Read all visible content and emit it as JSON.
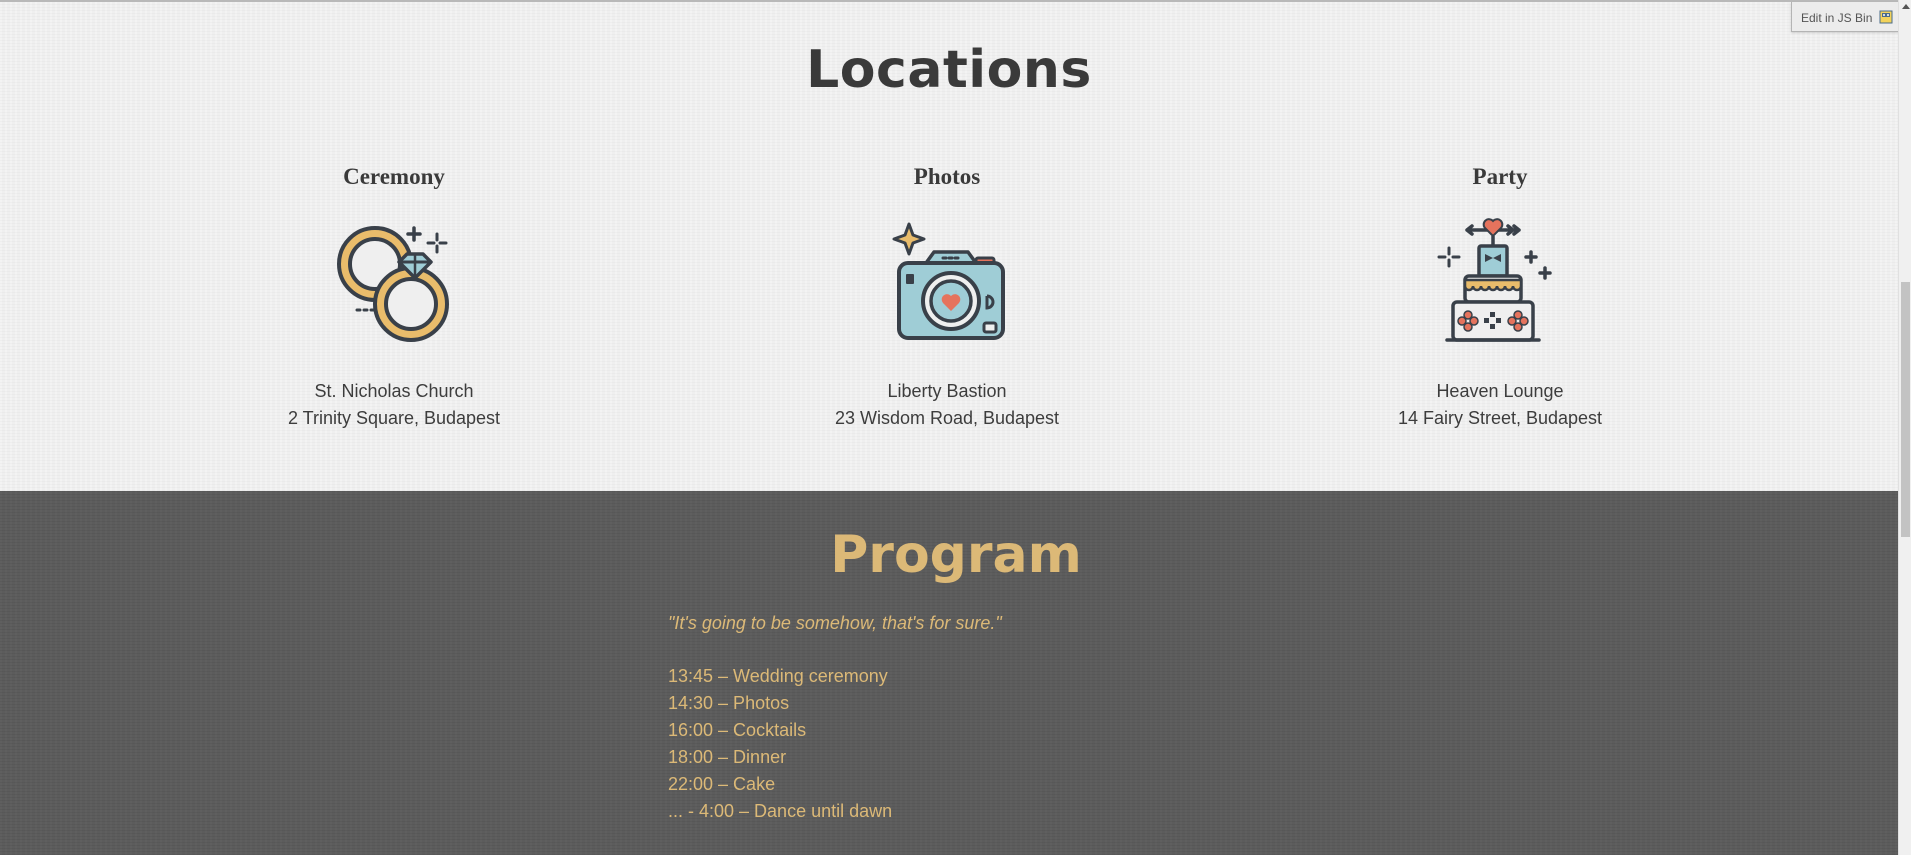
{
  "locations": {
    "title": "Locations",
    "venues": [
      {
        "name": "Ceremony",
        "icon": "wedding-rings-icon",
        "place": "St. Nicholas Church",
        "address": "2 Trinity Square, Budapest"
      },
      {
        "name": "Photos",
        "icon": "camera-icon",
        "place": "Liberty Bastion",
        "address": "23 Wisdom Road, Budapest"
      },
      {
        "name": "Party",
        "icon": "wedding-cake-icon",
        "place": "Heaven Lounge",
        "address": "14 Fairy Street, Budapest"
      }
    ]
  },
  "program": {
    "title": "Program",
    "quote": "\"It's going to be somehow, that's for sure.\"",
    "schedule": [
      "13:45 – Wedding ceremony",
      "14:30 – Photos",
      "16:00 – Cocktails",
      "18:00 – Dinner",
      "22:00 – Cake",
      "... - 4:00 – Dance until dawn"
    ]
  },
  "jsbin": {
    "label": "Edit in JS Bin"
  },
  "colors": {
    "accent": "#dcb977",
    "dark_bg": "#5c5c5c",
    "light_bg": "#efefef",
    "text": "#3a3a3a",
    "icon_teal": "#9fcdd6",
    "icon_red": "#e5735d"
  }
}
